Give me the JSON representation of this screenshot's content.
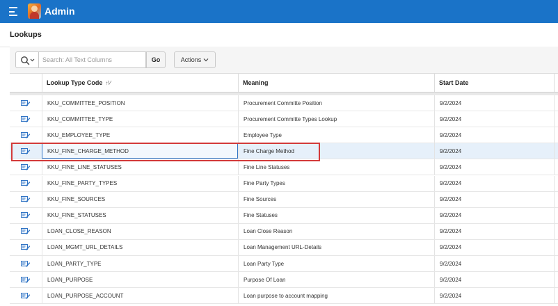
{
  "header": {
    "app_title": "Admin",
    "menu_icon": "hamburger-menu-icon",
    "logo_icon": "admin-user-logo-icon",
    "bar_color": "#1a73c8"
  },
  "page": {
    "title": "Lookups"
  },
  "toolbar": {
    "search_icon": "search-icon",
    "search_placeholder": "Search: All Text Columns",
    "search_value": "",
    "go_label": "Go",
    "actions_label": "Actions"
  },
  "table": {
    "columns": [
      {
        "label": ""
      },
      {
        "label": "Lookup Type Code",
        "sort_icon": "sort-ascending-icon"
      },
      {
        "label": "Meaning"
      },
      {
        "label": "Start Date"
      }
    ],
    "edit_icon": "edit-pencil-icon",
    "highlight_color": "#d33a3a",
    "rows": [
      {
        "code": "KKU_COMMITTEE_POSITION",
        "meaning": "Procurement Committe Position",
        "start_date": "9/2/2024"
      },
      {
        "code": "KKU_COMMITTEE_TYPE",
        "meaning": "Procurement Committe Types Lookup",
        "start_date": "9/2/2024"
      },
      {
        "code": "KKU_EMPLOYEE_TYPE",
        "meaning": "Employee Type",
        "start_date": "9/2/2024"
      },
      {
        "code": "KKU_FINE_CHARGE_METHOD",
        "meaning": "Fine Charge Method",
        "start_date": "9/2/2024",
        "selected": true
      },
      {
        "code": "KKU_FINE_LINE_STATUSES",
        "meaning": "Fine Line Statuses",
        "start_date": "9/2/2024"
      },
      {
        "code": "KKU_FINE_PARTY_TYPES",
        "meaning": "Fine Party Types",
        "start_date": "9/2/2024"
      },
      {
        "code": "KKU_FINE_SOURCES",
        "meaning": "Fine Sources",
        "start_date": "9/2/2024"
      },
      {
        "code": "KKU_FINE_STATUSES",
        "meaning": "Fine Statuses",
        "start_date": "9/2/2024"
      },
      {
        "code": "LOAN_CLOSE_REASON",
        "meaning": "Loan Close Reason",
        "start_date": "9/2/2024"
      },
      {
        "code": "LOAN_MGMT_URL_DETAILS",
        "meaning": "Loan Management URL-Details",
        "start_date": "9/2/2024"
      },
      {
        "code": "LOAN_PARTY_TYPE",
        "meaning": "Loan Party Type",
        "start_date": "9/2/2024"
      },
      {
        "code": "LOAN_PURPOSE",
        "meaning": "Purpose Of Loan",
        "start_date": "9/2/2024"
      },
      {
        "code": "LOAN_PURPOSE_ACCOUNT",
        "meaning": "Loan purpose to account mapping",
        "start_date": "9/2/2024"
      }
    ]
  }
}
